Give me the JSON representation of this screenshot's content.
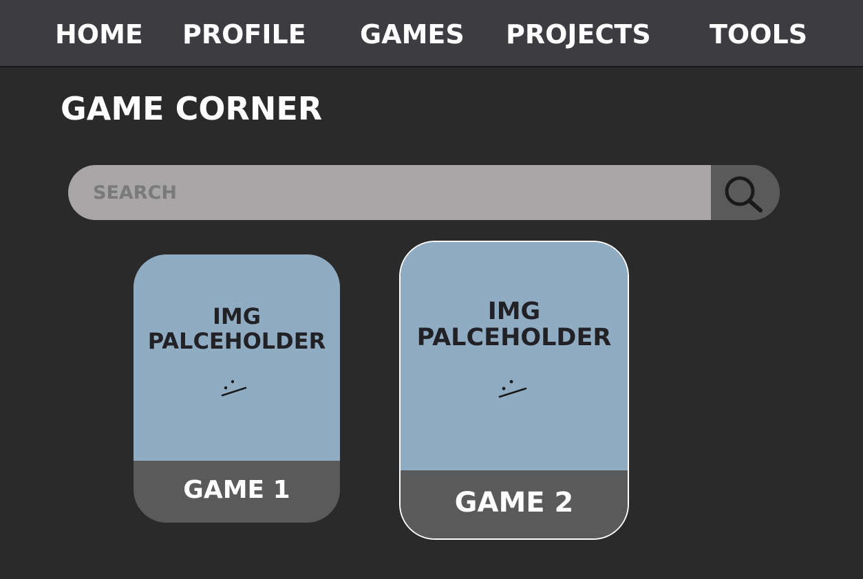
{
  "nav": {
    "items": [
      {
        "label": "HOME"
      },
      {
        "label": "PROFILE"
      },
      {
        "label": "GAMES"
      },
      {
        "label": "PROJECTS"
      },
      {
        "label": "TOOLS"
      }
    ]
  },
  "page": {
    "title": "GAME CORNER"
  },
  "search": {
    "placeholder": "SEARCH",
    "value": "",
    "button_icon": "search-icon"
  },
  "games": [
    {
      "image_placeholder": "IMG\nPALCEHOLDER",
      "face_icon": "sad-face-icon",
      "title": "GAME 1",
      "highlighted": false
    },
    {
      "image_placeholder": "IMG\nPALCEHOLDER",
      "face_icon": "sad-face-icon",
      "title": "GAME 2",
      "highlighted": true
    }
  ],
  "colors": {
    "background": "#2a2a2a",
    "navbar": "#3d3c41",
    "search_bar": "#a8a6a7",
    "search_button": "#5b5a5b",
    "card_image": "#8facc3",
    "card_footer": "#5a5a5a",
    "text_light": "#ffffff",
    "text_dark": "#222226"
  }
}
